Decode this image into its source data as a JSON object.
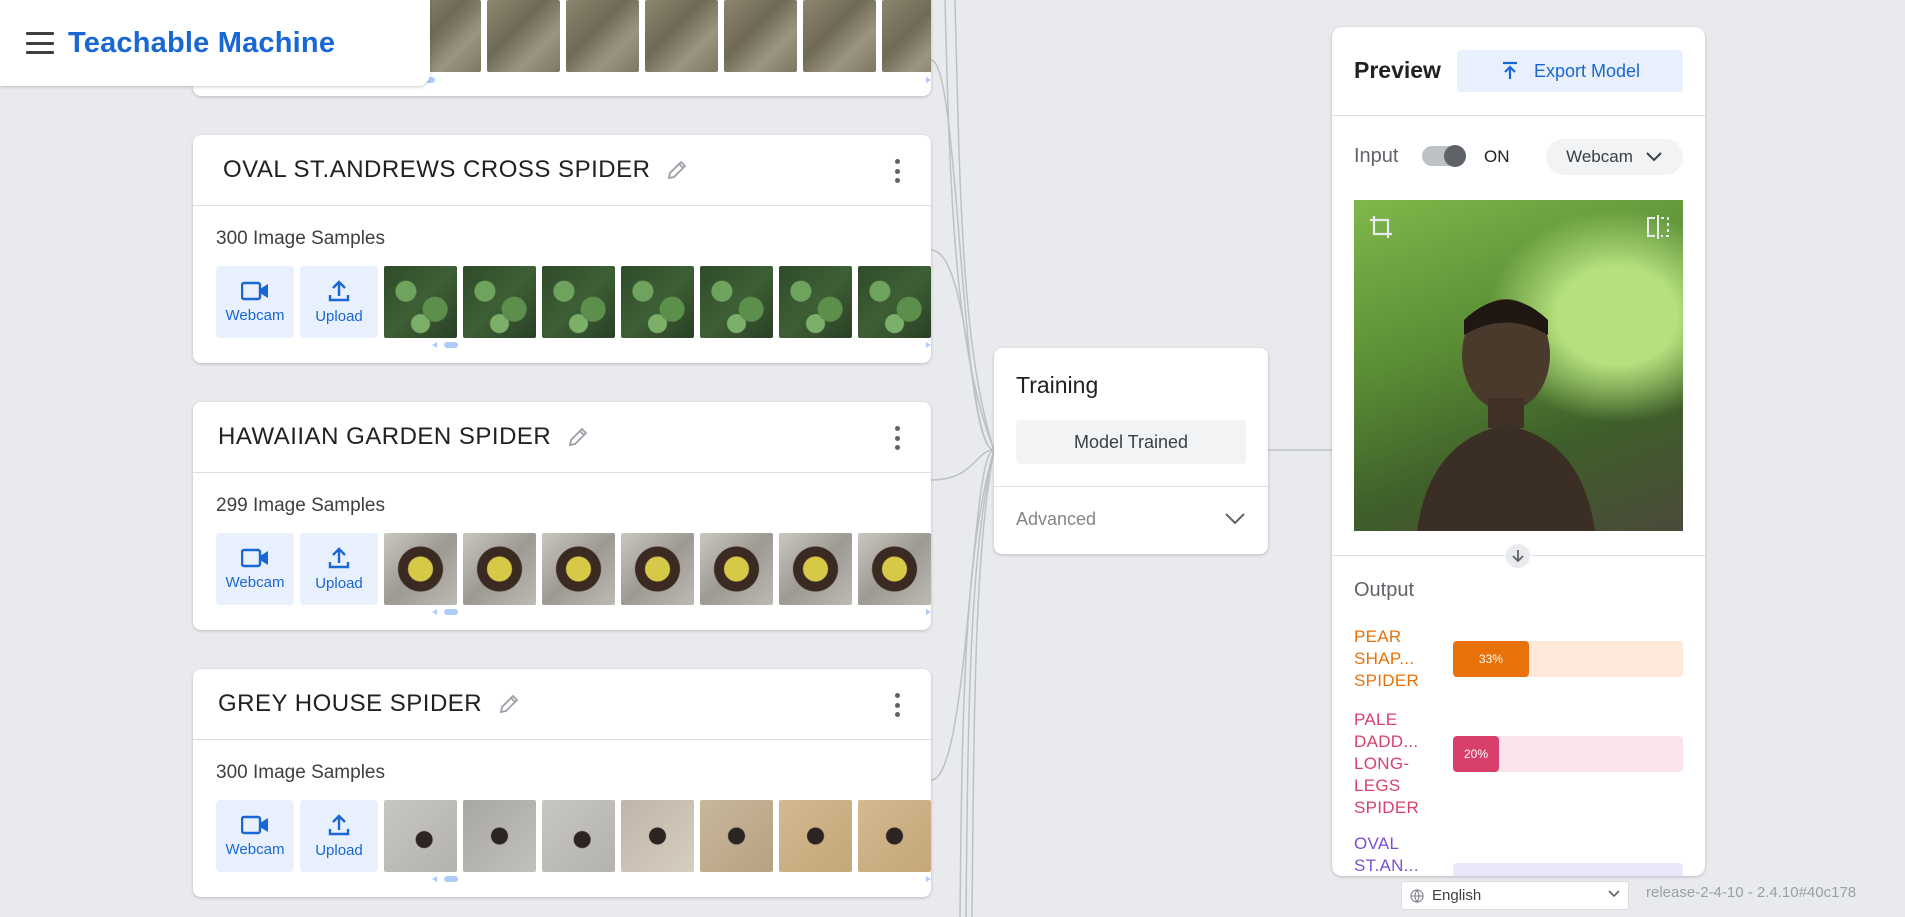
{
  "header": {
    "brand": "Teachable Machine",
    "menu_icon": "hamburger-menu-icon"
  },
  "classes": [
    {
      "name": "OVAL ST.ANDREWS CROSS SPIDER",
      "samples": "300 Image Samples",
      "webcam_label": "Webcam",
      "upload_label": "Upload",
      "thumb_style": "leaf"
    },
    {
      "name": "HAWAIIAN GARDEN SPIDER",
      "samples": "299 Image Samples",
      "webcam_label": "Webcam",
      "upload_label": "Upload",
      "thumb_style": "spider"
    },
    {
      "name": "GREY HOUSE SPIDER",
      "samples": "300 Image Samples",
      "webcam_label": "Webcam",
      "upload_label": "Upload",
      "thumb_style": "grey"
    }
  ],
  "training": {
    "title": "Training",
    "button_label": "Model Trained",
    "advanced_label": "Advanced"
  },
  "preview": {
    "title": "Preview",
    "export_label": "Export Model",
    "input_label": "Input",
    "input_toggle_state": "ON",
    "input_source": "Webcam",
    "output_label": "Output",
    "outputs": [
      {
        "label": "PEAR SHAP... SPIDER",
        "value": 33,
        "value_label": "33%",
        "color": "#e8710a",
        "track": "#fde8d9"
      },
      {
        "label": "PALE DADD... LONG-LEGS SPIDER",
        "value": 20,
        "value_label": "20%",
        "color": "#d93f6b",
        "track": "#fce4ec"
      },
      {
        "label": "OVAL ST.AN...",
        "value": null,
        "value_label": "",
        "color": "#7b4fd3",
        "track": "#ece6fb"
      }
    ]
  },
  "footer": {
    "language": "English",
    "release": "release-2-4-10 - 2.4.10#40c178"
  }
}
